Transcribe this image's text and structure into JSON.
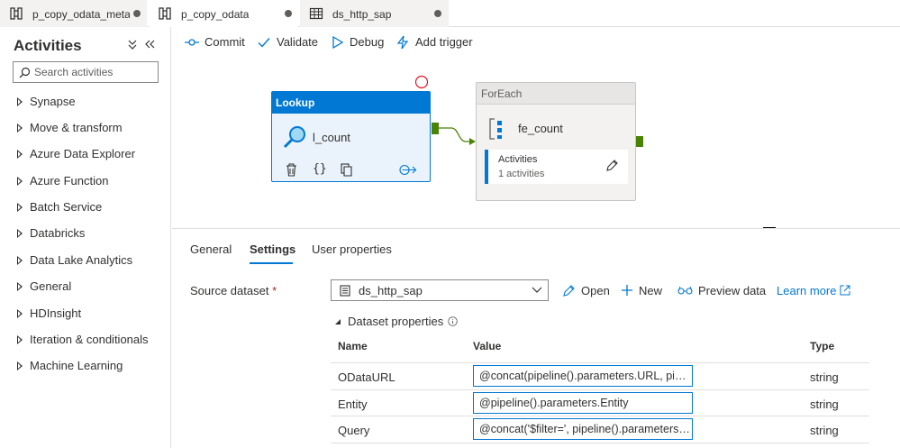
{
  "tabs": [
    {
      "label": "p_copy_odata_meta...",
      "icon": "pipeline-icon",
      "active": false
    },
    {
      "label": "p_copy_odata",
      "icon": "pipeline-icon",
      "active": true
    },
    {
      "label": "ds_http_sap",
      "icon": "table-icon",
      "active": false
    }
  ],
  "sidebar": {
    "title": "Activities",
    "search_placeholder": "Search activities",
    "categories": [
      "Synapse",
      "Move & transform",
      "Azure Data Explorer",
      "Azure Function",
      "Batch Service",
      "Databricks",
      "Data Lake Analytics",
      "General",
      "HDInsight",
      "Iteration & conditionals",
      "Machine Learning"
    ]
  },
  "toolbar": {
    "commit": "Commit",
    "validate": "Validate",
    "debug": "Debug",
    "add_trigger": "Add trigger"
  },
  "canvas": {
    "lookup": {
      "type_label": "Lookup",
      "name": "l_count"
    },
    "foreach": {
      "type_label": "ForEach",
      "name": "fe_count",
      "activities_title": "Activities",
      "activities_count": "1 activities"
    }
  },
  "panel": {
    "tabs": [
      "General",
      "Settings",
      "User properties"
    ],
    "active_tab": "Settings",
    "source_dataset_label": "Source dataset",
    "required_mark": "*",
    "source_dataset_value": "ds_http_sap",
    "open": "Open",
    "new": "New",
    "preview_data": "Preview data",
    "learn_more": "Learn more",
    "dataset_properties": "Dataset properties",
    "columns": {
      "name": "Name",
      "value": "Value",
      "type": "Type"
    },
    "properties": [
      {
        "name": "ODataURL",
        "value": "@concat(pipeline().parameters.URL, pipeline().parameters.Entity)",
        "type": "string"
      },
      {
        "name": "Entity",
        "value": "@pipeline().parameters.Entity",
        "type": "string"
      },
      {
        "name": "Query",
        "value": "@concat('$filter=', pipeline().parameters.Filter)",
        "type": "string"
      }
    ]
  },
  "colors": {
    "accent": "#0078d4",
    "success": "#498205",
    "error": "#e81123"
  }
}
